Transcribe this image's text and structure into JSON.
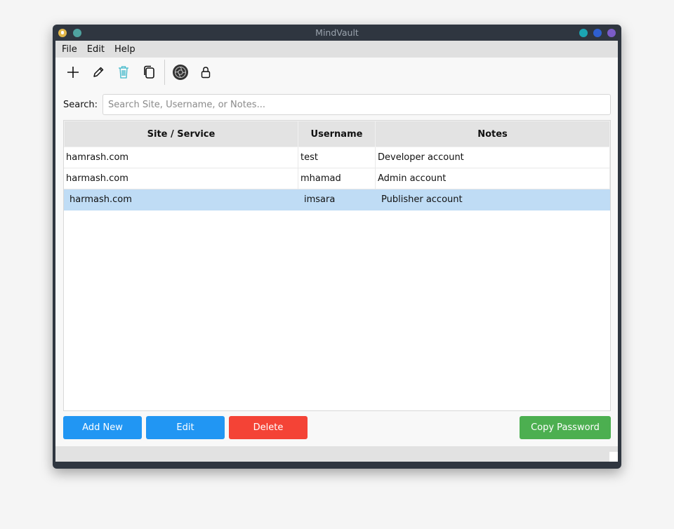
{
  "window": {
    "title": "MindVault",
    "controls": [
      {
        "name": "minimize-button",
        "color": "#1ba5b3"
      },
      {
        "name": "maximize-button",
        "color": "#2f5fcf"
      },
      {
        "name": "close-button",
        "color": "#7b5cc7"
      }
    ]
  },
  "menu": [
    "File",
    "Edit",
    "Help"
  ],
  "toolbar": {
    "icons": [
      "plus-icon",
      "pencil-icon",
      "trash-icon",
      "copy-icon",
      "settings-icon",
      "lock-icon"
    ]
  },
  "search": {
    "label": "Search:",
    "value": "",
    "placeholder": "Search Site, Username, or Notes..."
  },
  "table": {
    "columns": [
      "Site / Service",
      "Username",
      "Notes"
    ],
    "rows": [
      {
        "site": "hamrash.com",
        "username": "test",
        "notes": "Developer account",
        "selected": false
      },
      {
        "site": "harmash.com",
        "username": "mhamad",
        "notes": "Admin account",
        "selected": false
      },
      {
        "site": "harmash.com",
        "username": "imsara",
        "notes": "Publisher account",
        "selected": true
      }
    ]
  },
  "buttons": {
    "add": "Add New",
    "edit": "Edit",
    "delete": "Delete",
    "copy": "Copy Password"
  },
  "colors": {
    "primary": "#2196f3",
    "danger": "#f44336",
    "success": "#4caf50",
    "selection": "#bfdcf5",
    "trash": "#3fb7c9"
  }
}
